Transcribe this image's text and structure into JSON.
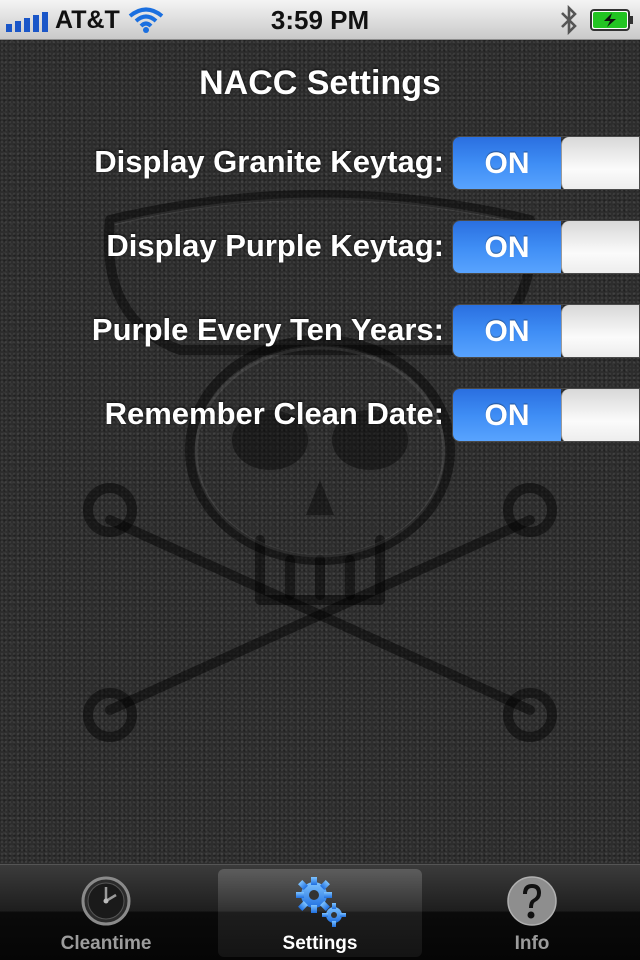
{
  "status_bar": {
    "carrier": "AT&T",
    "time": "3:59 PM"
  },
  "page": {
    "title": "NACC Settings"
  },
  "settings": [
    {
      "label": "Display Granite Keytag:",
      "state": "ON"
    },
    {
      "label": "Display Purple Keytag:",
      "state": "ON"
    },
    {
      "label": "Purple Every Ten Years:",
      "state": "ON"
    },
    {
      "label": "Remember Clean Date:",
      "state": "ON"
    }
  ],
  "tabs": [
    {
      "label": "Cleantime",
      "icon": "clock-icon"
    },
    {
      "label": "Settings",
      "icon": "gear-icon",
      "selected": true
    },
    {
      "label": "Info",
      "icon": "question-mark-icon"
    }
  ],
  "colors": {
    "switch_on": "#3f8ef5",
    "battery_green": "#22c422"
  }
}
